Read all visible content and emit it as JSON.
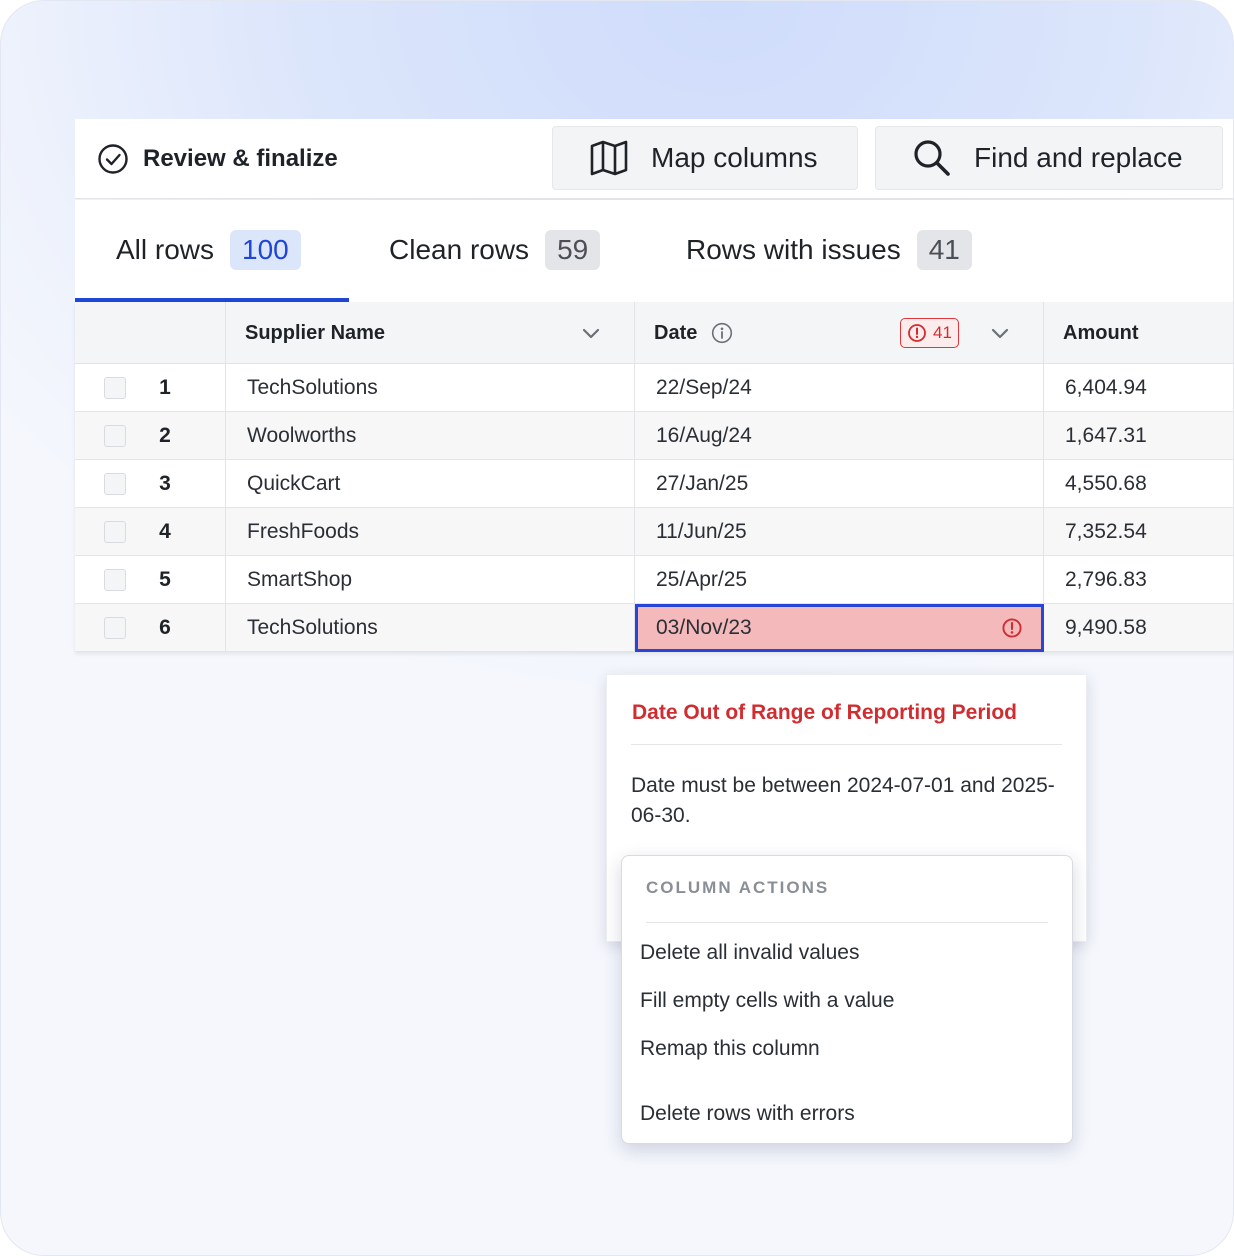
{
  "toolbar": {
    "review_label": "Review & finalize",
    "review_icon": "check-circle-icon",
    "map_label": "Map columns",
    "map_icon": "map-icon",
    "find_label": "Find and replace",
    "find_icon": "search-icon"
  },
  "tabs": [
    {
      "label": "All rows",
      "count": "100",
      "active": true
    },
    {
      "label": "Clean rows",
      "count": "59",
      "active": false
    },
    {
      "label": "Rows with issues",
      "count": "41",
      "active": false
    }
  ],
  "table": {
    "columns": {
      "supplier": "Supplier Name",
      "date": "Date",
      "amount": "Amount",
      "date_error_count": "41"
    },
    "rows": [
      {
        "num": "1",
        "supplier": "TechSolutions",
        "date": "22/Sep/24",
        "amount": "6,404.94"
      },
      {
        "num": "2",
        "supplier": "Woolworths",
        "date": "16/Aug/24",
        "amount": "1,647.31"
      },
      {
        "num": "3",
        "supplier": "QuickCart",
        "date": "27/Jan/25",
        "amount": "4,550.68"
      },
      {
        "num": "4",
        "supplier": "FreshFoods",
        "date": "11/Jun/25",
        "amount": "7,352.54"
      },
      {
        "num": "5",
        "supplier": "SmartShop",
        "date": "25/Apr/25",
        "amount": "2,796.83"
      },
      {
        "num": "6",
        "supplier": "TechSolutions",
        "date": "03/Nov/23",
        "amount": "9,490.58"
      }
    ]
  },
  "popover": {
    "title": "Date Out of Range of Reporting Period",
    "message": "Date must be between 2024-07-01 and 2025-06-30."
  },
  "menu": {
    "heading": "COLUMN ACTIONS",
    "items": [
      "Delete all invalid values",
      "Fill empty cells with a value",
      "Remap this column",
      "Delete rows with errors"
    ]
  },
  "colors": {
    "accent": "#1f46d6",
    "error": "#d12d31",
    "error_cell_bg": "#f4b9bb"
  }
}
